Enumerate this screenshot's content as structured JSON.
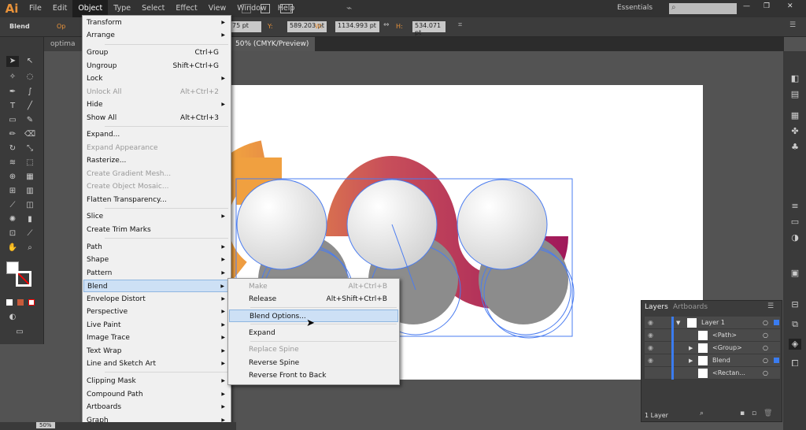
{
  "app": {
    "logo": "Ai",
    "menus": [
      "File",
      "Edit",
      "Object",
      "Type",
      "Select",
      "Effect",
      "View",
      "Window",
      "Help"
    ],
    "workspace": "Essentials",
    "search_placeholder": ""
  },
  "control": {
    "selection": "Blend",
    "opacity_label": "Op",
    "x_value": "75 pt",
    "y_label": "Y:",
    "y_value": "589.203 pt",
    "w_label": "W:",
    "w_value": "1134.993 pt",
    "h_label": "H:",
    "h_value": "534.071 pt"
  },
  "tabs": [
    "optima",
    "50% (CMYK/Preview)"
  ],
  "object_menu": [
    {
      "label": "Transform",
      "sub": true
    },
    {
      "label": "Arrange",
      "sub": true
    },
    {
      "label": "Group",
      "shortcut": "Ctrl+G"
    },
    {
      "label": "Ungroup",
      "shortcut": "Shift+Ctrl+G"
    },
    {
      "label": "Lock",
      "sub": true
    },
    {
      "label": "Unlock All",
      "shortcut": "Alt+Ctrl+2",
      "disabled": true
    },
    {
      "label": "Hide",
      "sub": true
    },
    {
      "label": "Show All",
      "shortcut": "Alt+Ctrl+3"
    },
    {
      "label": "Expand..."
    },
    {
      "label": "Expand Appearance",
      "disabled": true
    },
    {
      "label": "Rasterize..."
    },
    {
      "label": "Create Gradient Mesh...",
      "disabled": true
    },
    {
      "label": "Create Object Mosaic...",
      "disabled": true
    },
    {
      "label": "Flatten Transparency..."
    },
    {
      "label": "Slice",
      "sub": true
    },
    {
      "label": "Create Trim Marks"
    },
    {
      "label": "Path",
      "sub": true
    },
    {
      "label": "Shape",
      "sub": true
    },
    {
      "label": "Pattern",
      "sub": true
    },
    {
      "label": "Blend",
      "sub": true,
      "highlighted": true
    },
    {
      "label": "Envelope Distort",
      "sub": true
    },
    {
      "label": "Perspective",
      "sub": true
    },
    {
      "label": "Live Paint",
      "sub": true
    },
    {
      "label": "Image Trace",
      "sub": true
    },
    {
      "label": "Text Wrap",
      "sub": true
    },
    {
      "label": "Line and Sketch Art",
      "sub": true
    },
    {
      "label": "Clipping Mask",
      "sub": true
    },
    {
      "label": "Compound Path",
      "sub": true
    },
    {
      "label": "Artboards",
      "sub": true
    },
    {
      "label": "Graph",
      "sub": true
    }
  ],
  "blend_menu": [
    {
      "label": "Make",
      "shortcut": "Alt+Ctrl+B",
      "disabled": true
    },
    {
      "label": "Release",
      "shortcut": "Alt+Shift+Ctrl+B"
    },
    {
      "label": "Blend Options...",
      "highlighted": true
    },
    {
      "label": "Expand"
    },
    {
      "label": "Replace Spine",
      "disabled": true
    },
    {
      "label": "Reverse Spine"
    },
    {
      "label": "Reverse Front to Back"
    }
  ],
  "layers": {
    "tabs": [
      "Layers",
      "Artboards"
    ],
    "rows": [
      "Layer 1",
      "<Path>",
      "<Group>",
      "Blend",
      "<Rectan..."
    ],
    "count": "1 Layer"
  },
  "status": {
    "zoom": "50%"
  },
  "colors": {
    "accent": "#e8923a",
    "ribbon_start": "#f0a040",
    "ribbon_end": "#a0185a",
    "selection": "#4a7cf0"
  }
}
